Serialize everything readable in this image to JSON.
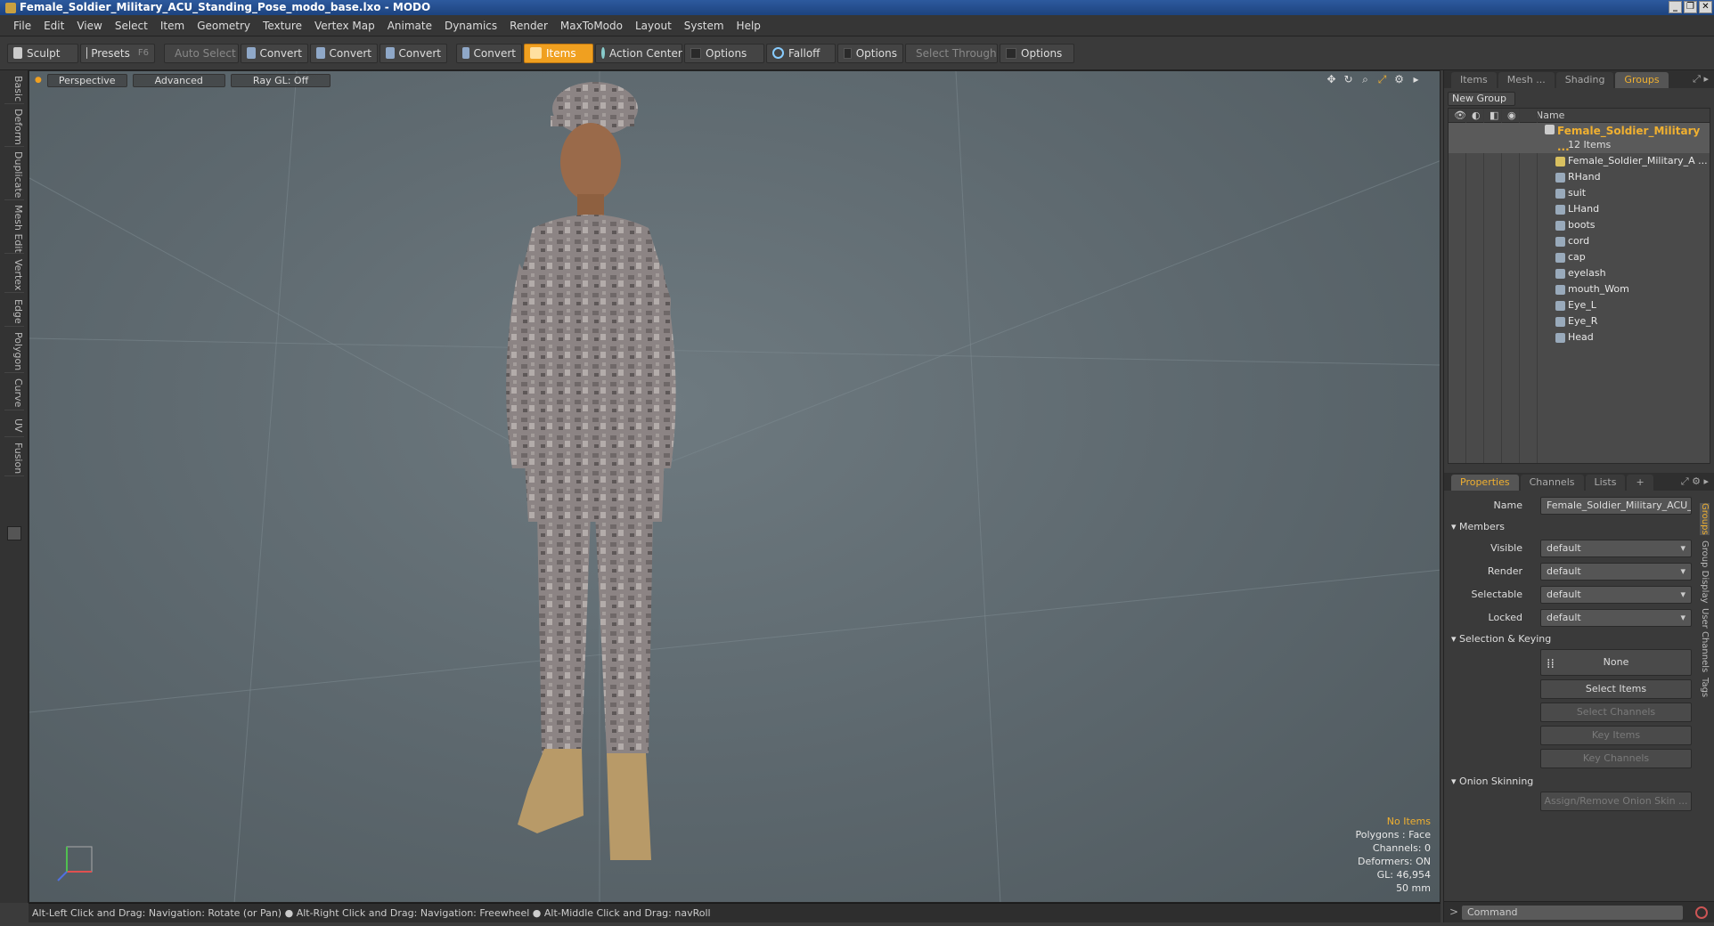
{
  "window": {
    "title": "Female_Soldier_Military_ACU_Standing_Pose_modo_base.lxo - MODO",
    "controls": [
      "_",
      "❐",
      "✕"
    ]
  },
  "menu": [
    "File",
    "Edit",
    "View",
    "Select",
    "Item",
    "Geometry",
    "Texture",
    "Vertex Map",
    "Animate",
    "Dynamics",
    "Render",
    "MaxToModo",
    "Layout",
    "System",
    "Help"
  ],
  "toolbar": {
    "sculpt": "Sculpt",
    "presets": "Presets",
    "presets_key": "F6",
    "auto_select": "Auto Select",
    "convert1": "Convert",
    "convert2": "Convert",
    "convert3": "Convert",
    "convert4": "Convert",
    "items": "Items",
    "action_center": "Action Center",
    "options1": "Options",
    "falloff": "Falloff",
    "options2": "Options",
    "select_through": "Select Through",
    "options3": "Options"
  },
  "lefttabs": [
    "Basic",
    "Deform",
    "Duplicate",
    "Mesh Edit",
    "Vertex",
    "Edge",
    "Polygon",
    "Curve",
    "UV",
    "Fusion"
  ],
  "viewport": {
    "perspective": "Perspective",
    "advanced": "Advanced",
    "raygl": "Ray GL: Off",
    "icons": [
      "move-icon",
      "rotate-icon",
      "zoom-icon",
      "fit-icon",
      "gear-icon",
      "arrow-icon"
    ],
    "info": {
      "no_items": "No Items",
      "polygons": "Polygons : Face",
      "channels": "Channels: 0",
      "deformers": "Deformers: ON",
      "gl": "GL: 46,954",
      "lens": "50 mm"
    }
  },
  "status": "Alt-Left Click and Drag: Navigation: Rotate (or Pan) ● Alt-Right Click and Drag: Navigation: Freewheel ● Alt-Middle Click and Drag: navRoll",
  "panel_top": {
    "tabs": [
      "Items",
      "Mesh ...",
      "Shading",
      "Groups"
    ],
    "active": "Groups",
    "new_group": "New Group",
    "name_header": "Name"
  },
  "group": {
    "name": "Female_Soldier_Military ...",
    "count": "12 Items",
    "children": [
      "Female_Soldier_Military_A ...",
      "RHand",
      "suit",
      "LHand",
      "boots",
      "cord",
      "cap",
      "eyelash",
      "mouth_Wom",
      "Eye_L",
      "Eye_R",
      "Head"
    ]
  },
  "panel_bottom": {
    "tabs": [
      "Properties",
      "Channels",
      "Lists",
      "+"
    ],
    "active": "Properties",
    "name_label": "Name",
    "name_value": "Female_Soldier_Military_ACU_St",
    "members": "Members",
    "visible_label": "Visible",
    "visible_value": "default",
    "render_label": "Render",
    "render_value": "default",
    "selectable_label": "Selectable",
    "selectable_value": "default",
    "locked_label": "Locked",
    "locked_value": "default",
    "selkey": "Selection & Keying",
    "none": "None",
    "select_items": "Select Items",
    "select_channels": "Select Channels",
    "key_items": "Key Items",
    "key_channels": "Key Channels",
    "onion": "Onion Skinning",
    "assign_onion": "Assign/Remove Onion Skin ...",
    "sidetabs": [
      "Groups",
      "Group Display",
      "User Channels",
      "Tags"
    ]
  },
  "command": {
    "placeholder": "Command"
  }
}
